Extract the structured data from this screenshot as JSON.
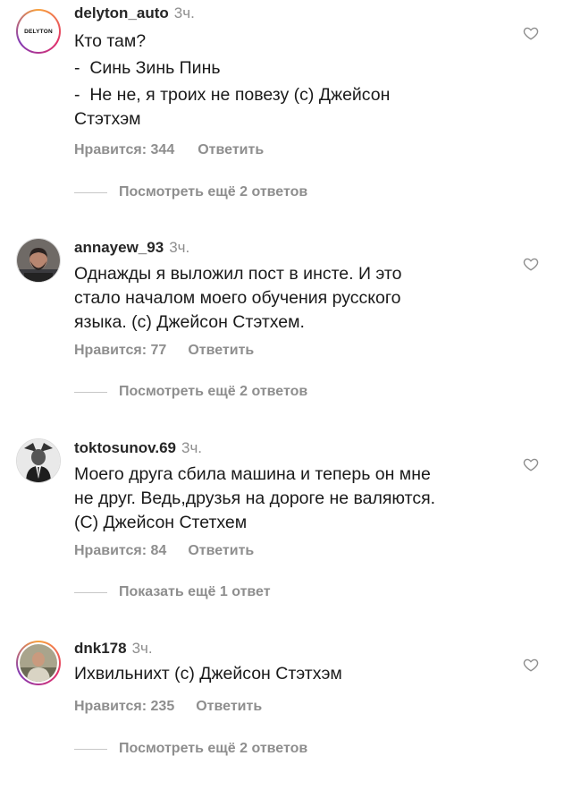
{
  "comments": [
    {
      "username": "delyton_auto",
      "time": "3ч.",
      "avatar_text": "DELYTON",
      "lines": [
        "Кто там?",
        "-  Синь Зинь Пинь",
        "-  Не не, я троих не повезу (с) Джейсон",
        "Стэтхэм"
      ],
      "likes": "Нравится: 344",
      "reply": "Ответить",
      "more": "Посмотреть ещё 2 ответов"
    },
    {
      "username": "annayew_93",
      "time": "3ч.",
      "lines": [
        "Однажды я выложил пост в инсте. И это",
        "стало началом моего обучения русского",
        "языка. (с) Джейсон Стэтхем."
      ],
      "likes": "Нравится: 77",
      "reply": "Ответить",
      "more": "Посмотреть ещё 2 ответов"
    },
    {
      "username": "toktosunov.69",
      "time": "3ч.",
      "lines": [
        "Моего друга сбила машина и теперь он мне",
        "не друг. Ведь,друзья на дороге не валяются.",
        "(С) Джейсон Стетхем"
      ],
      "likes": "Нравится: 84",
      "reply": "Ответить",
      "more": "Показать ещё 1 ответ"
    },
    {
      "username": "dnk178",
      "time": "3ч.",
      "lines": [
        "Ихвильнихт (с) Джейсон Стэтхэм"
      ],
      "likes": "Нравится: 235",
      "reply": "Ответить",
      "more": "Посмотреть ещё 2 ответов"
    }
  ],
  "icons": {
    "heart": "heart-outline-icon",
    "avatar": "avatar-photo"
  },
  "colors": {
    "text": "#262626",
    "muted": "#8e8e8e",
    "story_ring": "#e1306c"
  }
}
